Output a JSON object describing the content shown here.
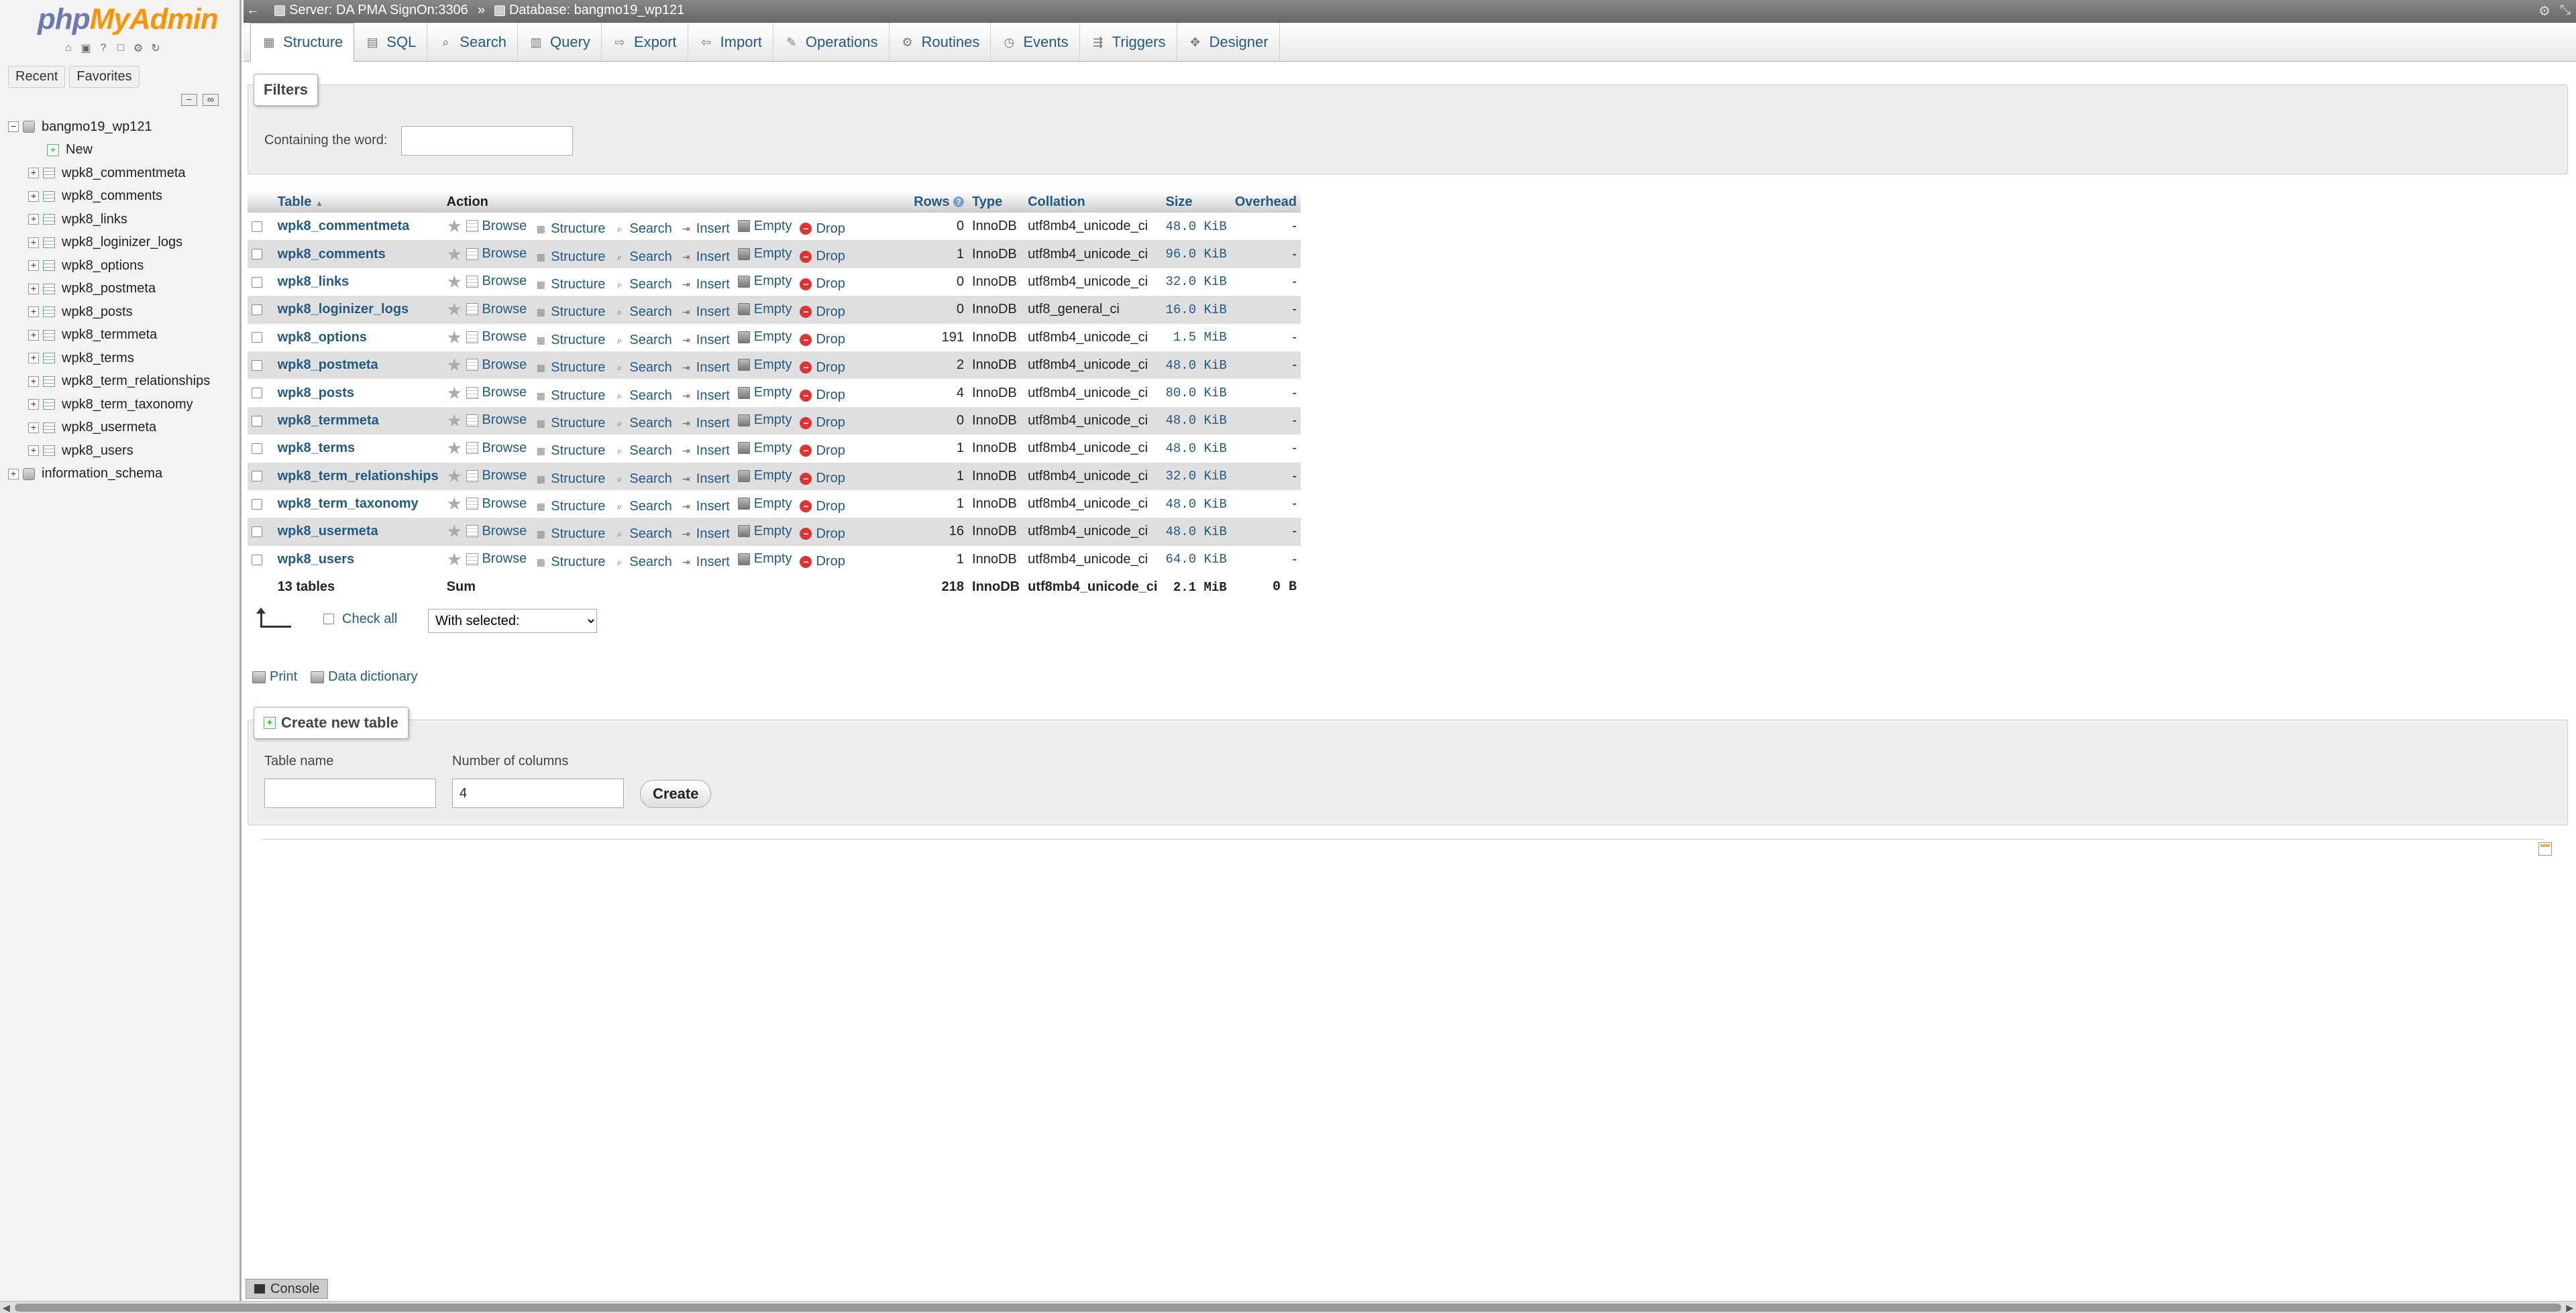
{
  "app": {
    "logo_php": "php",
    "logo_my": "My",
    "logo_admin": "Admin"
  },
  "sidebar": {
    "recent_label": "Recent",
    "favorites_label": "Favorites",
    "tree": [
      {
        "label": "bangmo19_wp121",
        "kind": "db",
        "expanded": true
      },
      {
        "label": "New",
        "kind": "new"
      },
      {
        "label": "wpk8_commentmeta",
        "kind": "table"
      },
      {
        "label": "wpk8_comments",
        "kind": "table"
      },
      {
        "label": "wpk8_links",
        "kind": "table"
      },
      {
        "label": "wpk8_loginizer_logs",
        "kind": "table"
      },
      {
        "label": "wpk8_options",
        "kind": "table"
      },
      {
        "label": "wpk8_postmeta",
        "kind": "table"
      },
      {
        "label": "wpk8_posts",
        "kind": "table"
      },
      {
        "label": "wpk8_termmeta",
        "kind": "table"
      },
      {
        "label": "wpk8_terms",
        "kind": "table"
      },
      {
        "label": "wpk8_term_relationships",
        "kind": "table"
      },
      {
        "label": "wpk8_term_taxonomy",
        "kind": "table"
      },
      {
        "label": "wpk8_usermeta",
        "kind": "table"
      },
      {
        "label": "wpk8_users",
        "kind": "table"
      },
      {
        "label": "information_schema",
        "kind": "db",
        "expanded": false
      }
    ]
  },
  "topbar": {
    "server": "Server: DA PMA SignOn:3306",
    "separator": "»",
    "database": "Database: bangmo19_wp121"
  },
  "tabs": [
    {
      "label": "Structure",
      "icon": "structure-icon",
      "active": true
    },
    {
      "label": "SQL",
      "icon": "sql-icon"
    },
    {
      "label": "Search",
      "icon": "search-icon"
    },
    {
      "label": "Query",
      "icon": "query-icon"
    },
    {
      "label": "Export",
      "icon": "export-icon"
    },
    {
      "label": "Import",
      "icon": "import-icon"
    },
    {
      "label": "Operations",
      "icon": "wrench-icon"
    },
    {
      "label": "Routines",
      "icon": "routines-icon"
    },
    {
      "label": "Events",
      "icon": "events-icon"
    },
    {
      "label": "Triggers",
      "icon": "triggers-icon"
    },
    {
      "label": "Designer",
      "icon": "designer-icon"
    }
  ],
  "filters": {
    "legend": "Filters",
    "containing_label": "Containing the word:",
    "containing_value": ""
  },
  "table": {
    "headers": {
      "table": "Table",
      "action": "Action",
      "rows": "Rows",
      "type": "Type",
      "collation": "Collation",
      "size": "Size",
      "overhead": "Overhead"
    },
    "actions": {
      "browse": "Browse",
      "structure": "Structure",
      "search": "Search",
      "insert": "Insert",
      "empty": "Empty",
      "drop": "Drop"
    },
    "rows": [
      {
        "name": "wpk8_commentmeta",
        "rows": "0",
        "type": "InnoDB",
        "collation": "utf8mb4_unicode_ci",
        "size": "48.0 KiB",
        "overhead": "-"
      },
      {
        "name": "wpk8_comments",
        "rows": "1",
        "type": "InnoDB",
        "collation": "utf8mb4_unicode_ci",
        "size": "96.0 KiB",
        "overhead": "-"
      },
      {
        "name": "wpk8_links",
        "rows": "0",
        "type": "InnoDB",
        "collation": "utf8mb4_unicode_ci",
        "size": "32.0 KiB",
        "overhead": "-"
      },
      {
        "name": "wpk8_loginizer_logs",
        "rows": "0",
        "type": "InnoDB",
        "collation": "utf8_general_ci",
        "size": "16.0 KiB",
        "overhead": "-"
      },
      {
        "name": "wpk8_options",
        "rows": "191",
        "type": "InnoDB",
        "collation": "utf8mb4_unicode_ci",
        "size": "1.5 MiB",
        "overhead": "-"
      },
      {
        "name": "wpk8_postmeta",
        "rows": "2",
        "type": "InnoDB",
        "collation": "utf8mb4_unicode_ci",
        "size": "48.0 KiB",
        "overhead": "-"
      },
      {
        "name": "wpk8_posts",
        "rows": "4",
        "type": "InnoDB",
        "collation": "utf8mb4_unicode_ci",
        "size": "80.0 KiB",
        "overhead": "-"
      },
      {
        "name": "wpk8_termmeta",
        "rows": "0",
        "type": "InnoDB",
        "collation": "utf8mb4_unicode_ci",
        "size": "48.0 KiB",
        "overhead": "-"
      },
      {
        "name": "wpk8_terms",
        "rows": "1",
        "type": "InnoDB",
        "collation": "utf8mb4_unicode_ci",
        "size": "48.0 KiB",
        "overhead": "-"
      },
      {
        "name": "wpk8_term_relationships",
        "rows": "1",
        "type": "InnoDB",
        "collation": "utf8mb4_unicode_ci",
        "size": "32.0 KiB",
        "overhead": "-"
      },
      {
        "name": "wpk8_term_taxonomy",
        "rows": "1",
        "type": "InnoDB",
        "collation": "utf8mb4_unicode_ci",
        "size": "48.0 KiB",
        "overhead": "-"
      },
      {
        "name": "wpk8_usermeta",
        "rows": "16",
        "type": "InnoDB",
        "collation": "utf8mb4_unicode_ci",
        "size": "48.0 KiB",
        "overhead": "-"
      },
      {
        "name": "wpk8_users",
        "rows": "1",
        "type": "InnoDB",
        "collation": "utf8mb4_unicode_ci",
        "size": "64.0 KiB",
        "overhead": "-"
      }
    ],
    "summary": {
      "count": "13 tables",
      "sum_label": "Sum",
      "rows": "218",
      "type": "InnoDB",
      "collation": "utf8mb4_unicode_ci",
      "size": "2.1 MiB",
      "overhead": "0 B"
    }
  },
  "bulk": {
    "check_all": "Check all",
    "with_selected": "With selected:"
  },
  "links": {
    "print": "Print",
    "data_dictionary": "Data dictionary"
  },
  "create_table": {
    "legend": "Create new table",
    "name_label": "Table name",
    "name_value": "",
    "columns_label": "Number of columns",
    "columns_value": "4",
    "create_button": "Create"
  },
  "console": {
    "label": "Console"
  }
}
